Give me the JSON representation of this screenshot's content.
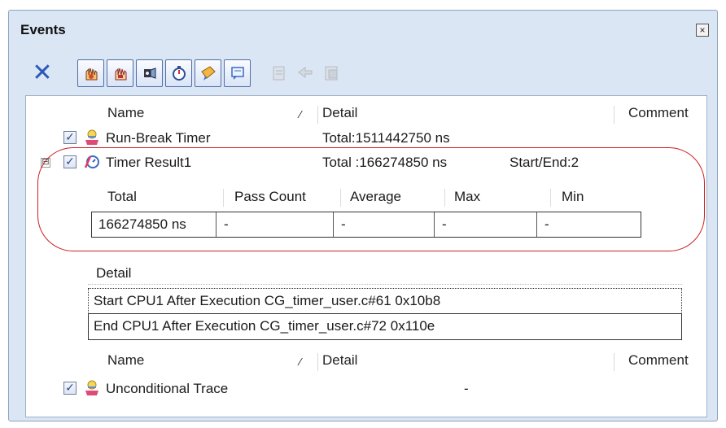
{
  "panel": {
    "title": "Events",
    "close_glyph": "×"
  },
  "toolbar": {
    "delete_glyph": "✕",
    "buttons": [
      {
        "icon": "hardware-break-icon"
      },
      {
        "icon": "software-break-icon"
      },
      {
        "icon": "trace-icon"
      },
      {
        "icon": "timer-icon"
      },
      {
        "icon": "point-trace-icon"
      },
      {
        "icon": "script-icon"
      }
    ],
    "disabled_buttons": [
      {
        "icon": "edit-icon"
      },
      {
        "icon": "copy-icon"
      },
      {
        "icon": "paste-icon"
      }
    ]
  },
  "header": {
    "name": "Name",
    "detail": "Detail",
    "comment": "Comment",
    "sort_glyph": "⁄"
  },
  "events": [
    {
      "name": "Run-Break Timer",
      "detail": "Total:1511442750 ns",
      "checked": "✓"
    },
    {
      "name": "Timer Result1",
      "detail": "Total :166274850 ns",
      "extra": "Start/End:2",
      "checked": "✓",
      "expander": "⊟"
    }
  ],
  "stats": {
    "headers": [
      "Total",
      "Pass Count",
      "Average",
      "Max",
      "Min"
    ],
    "values": [
      "166274850 ns",
      "-",
      "-",
      "-",
      "-"
    ]
  },
  "detail_section": {
    "label": "Detail",
    "rows": [
      "Start CPU1 After Execution CG_timer_user.c#61 0x10b8",
      "End CPU1 After Execution CG_timer_user.c#72 0x110e"
    ]
  },
  "header2": {
    "name": "Name",
    "detail": "Detail",
    "comment": "Comment"
  },
  "events2": [
    {
      "name": "Unconditional Trace",
      "detail": "-",
      "checked": "✓"
    }
  ]
}
